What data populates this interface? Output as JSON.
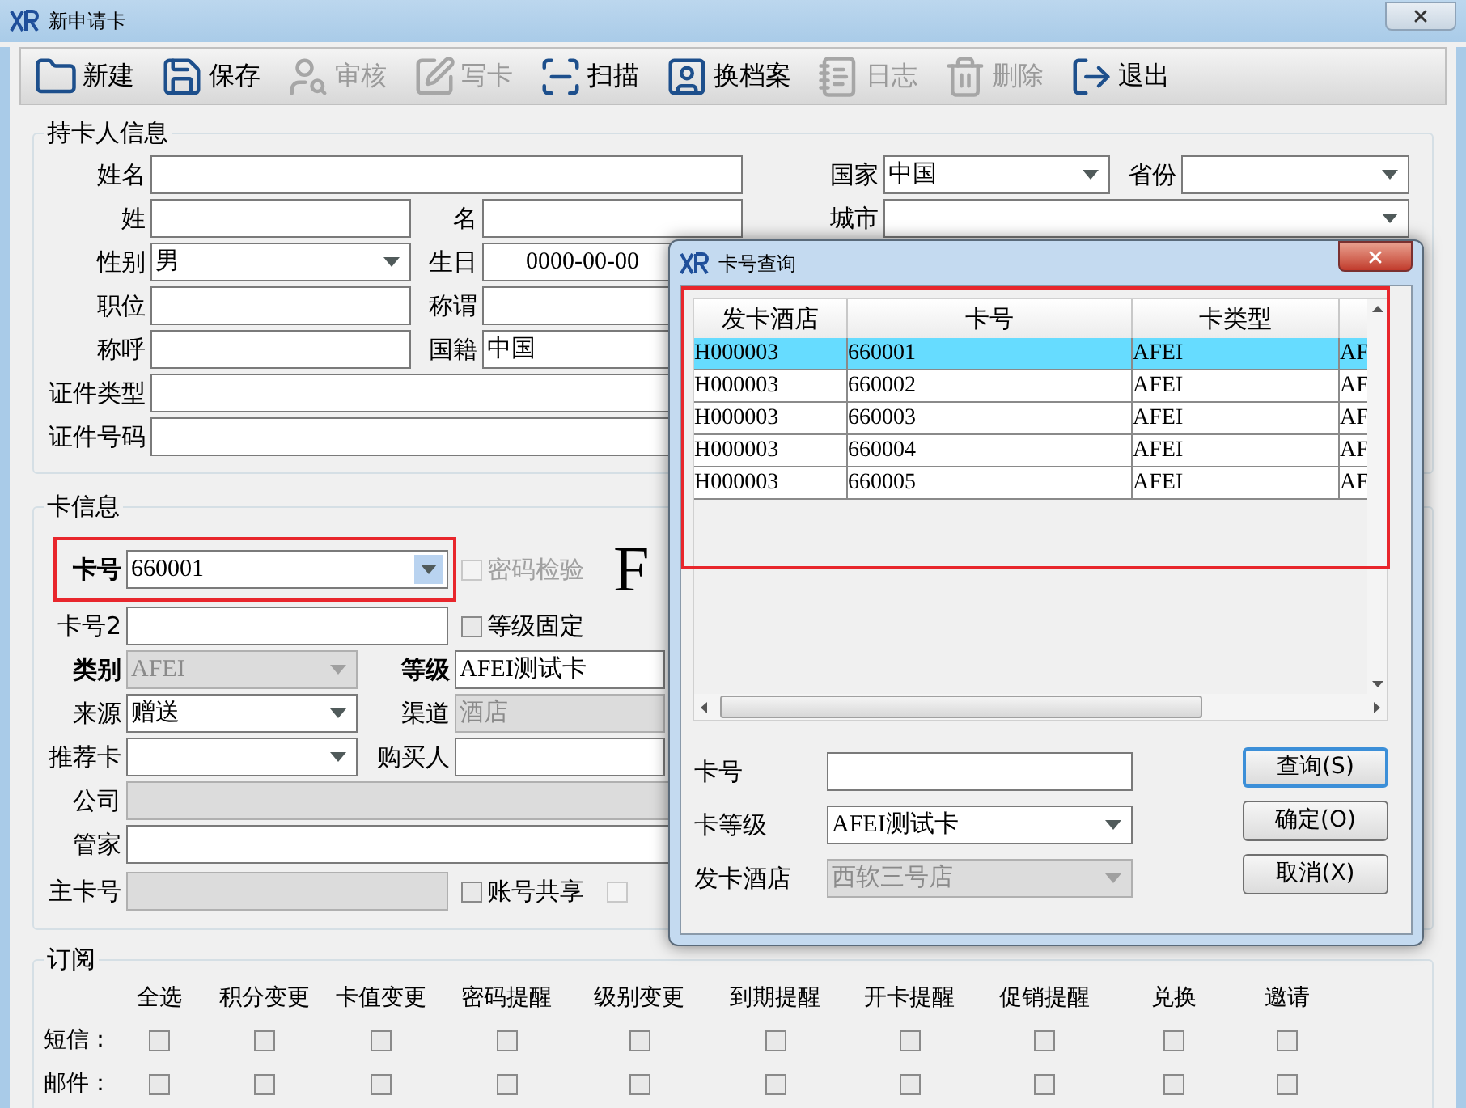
{
  "window": {
    "title": "新申请卡"
  },
  "toolbar": [
    {
      "label": "新建",
      "disabled": false
    },
    {
      "label": "保存",
      "disabled": false
    },
    {
      "label": "审核",
      "disabled": true
    },
    {
      "label": "写卡",
      "disabled": true
    },
    {
      "label": "扫描",
      "disabled": false
    },
    {
      "label": "换档案",
      "disabled": false
    },
    {
      "label": "日志",
      "disabled": true
    },
    {
      "label": "删除",
      "disabled": true
    },
    {
      "label": "退出",
      "disabled": false
    }
  ],
  "holder_info": {
    "title": "持卡人信息",
    "fields": [
      {
        "label": "姓名",
        "kind": "text"
      },
      {
        "label": "国家",
        "kind": "select",
        "value": "中国"
      },
      {
        "label": "省份",
        "kind": "select"
      },
      {
        "label": "姓",
        "kind": "text"
      },
      {
        "label": "名",
        "kind": "text"
      },
      {
        "label": "城市",
        "kind": "select"
      },
      {
        "label": "性别",
        "kind": "select",
        "value": "男"
      },
      {
        "label": "生日",
        "kind": "text",
        "value": "0000-00-00"
      },
      {
        "label": "职位",
        "kind": "text"
      },
      {
        "label": "称谓",
        "kind": "text"
      },
      {
        "label": "称呼",
        "kind": "text"
      },
      {
        "label": "国籍",
        "kind": "text",
        "value": "中国"
      },
      {
        "label": "证件类型",
        "kind": "text"
      },
      {
        "label": "证件号码",
        "kind": "text"
      }
    ]
  },
  "card_info": {
    "title": "卡信息",
    "big_letter": "F",
    "fields": [
      {
        "label": "卡号",
        "kind": "select",
        "value": "660001",
        "emphasized": true,
        "disabled": false
      },
      {
        "label": "卡号2",
        "kind": "text",
        "emphasized": false,
        "disabled": false
      },
      {
        "label": "类别",
        "kind": "select",
        "value": "AFEI",
        "emphasized": true,
        "disabled": true
      },
      {
        "label": "等级",
        "kind": "text",
        "value": "AFEI测试卡",
        "emphasized": true,
        "disabled": false
      },
      {
        "label": "来源",
        "kind": "select",
        "value": "赠送",
        "emphasized": false,
        "disabled": false
      },
      {
        "label": "渠道",
        "kind": "text",
        "value": "酒店",
        "emphasized": false,
        "disabled": true
      },
      {
        "label": "推荐卡",
        "kind": "select",
        "emphasized": false,
        "disabled": false
      },
      {
        "label": "购买人",
        "kind": "text",
        "emphasized": false,
        "disabled": false
      },
      {
        "label": "公司",
        "kind": "text",
        "emphasized": false,
        "disabled": true
      },
      {
        "label": "管家",
        "kind": "text",
        "emphasized": false,
        "disabled": false
      },
      {
        "label": "主卡号",
        "kind": "text",
        "emphasized": false,
        "disabled": true
      }
    ],
    "checkboxes": [
      {
        "label": "密码检验",
        "checked": false,
        "disabled": true
      },
      {
        "label": "等级固定",
        "checked": false,
        "disabled": false
      },
      {
        "label": "账号共享",
        "checked": false,
        "disabled": false
      },
      {
        "checked": false,
        "disabled": true
      }
    ]
  },
  "subscription": {
    "title": "订阅",
    "columns": [
      "全选",
      "积分变更",
      "卡值变更",
      "密码提醒",
      "级别变更",
      "到期提醒",
      "开卡提醒",
      "促销提醒",
      "兑换",
      "邀请"
    ],
    "rows": [
      {
        "label": "短信：",
        "checks": [
          false,
          false,
          false,
          false,
          false,
          false,
          false,
          false,
          false,
          false
        ]
      },
      {
        "label": "邮件：",
        "checks": [
          false,
          false,
          false,
          false,
          false,
          false,
          false,
          false,
          false,
          false
        ]
      }
    ]
  },
  "dialog": {
    "title": "卡号查询",
    "table": {
      "columns": [
        "发卡酒店",
        "卡号",
        "卡类型"
      ],
      "rows": [
        {
          "cells": [
            "H000003",
            "660001",
            "AFEI",
            "AF"
          ],
          "selected": true
        },
        {
          "cells": [
            "H000003",
            "660002",
            "AFEI",
            "AF"
          ],
          "selected": false
        },
        {
          "cells": [
            "H000003",
            "660003",
            "AFEI",
            "AF"
          ],
          "selected": false
        },
        {
          "cells": [
            "H000003",
            "660004",
            "AFEI",
            "AF"
          ],
          "selected": false
        },
        {
          "cells": [
            "H000003",
            "660005",
            "AFEI",
            "AF"
          ],
          "selected": false
        }
      ]
    },
    "fields": [
      {
        "label": "卡号",
        "kind": "text",
        "disabled": false
      },
      {
        "label": "卡等级",
        "kind": "select",
        "value": "AFEI测试卡",
        "disabled": false
      },
      {
        "label": "发卡酒店",
        "kind": "select",
        "value": "西软三号店",
        "disabled": true
      }
    ],
    "buttons": [
      "查询(S)",
      "确定(O)",
      "取消(X)"
    ]
  }
}
